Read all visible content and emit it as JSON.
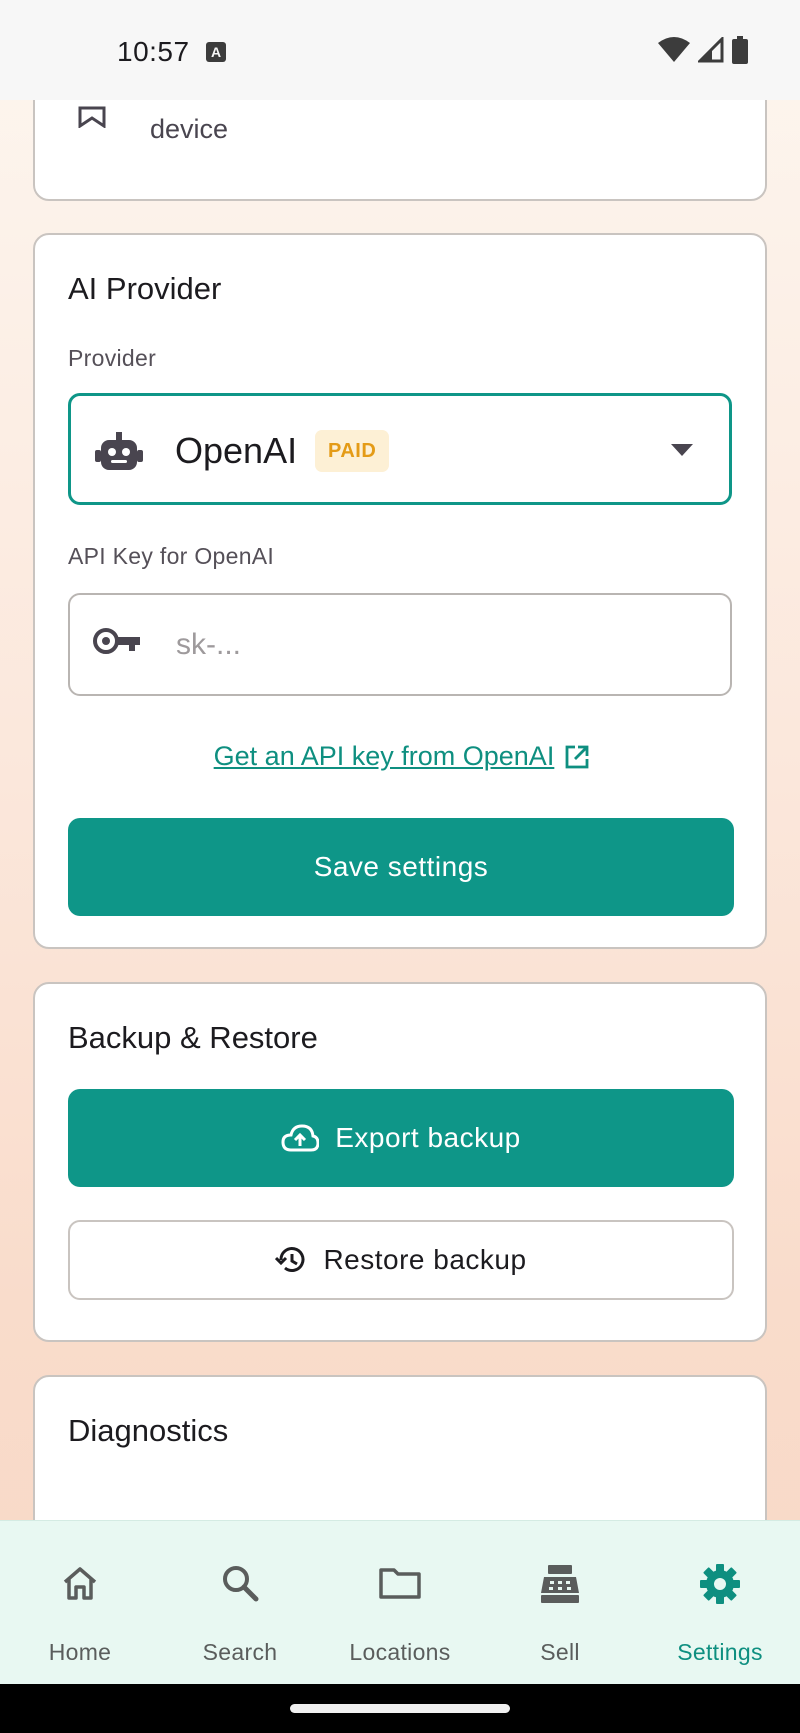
{
  "status_bar": {
    "time": "10:57",
    "indicator": "A"
  },
  "top_card": {
    "partial_text": "device"
  },
  "ai_provider": {
    "title": "AI Provider",
    "provider_label": "Provider",
    "provider_value": "OpenAI",
    "provider_badge": "PAID",
    "api_key_label": "API Key for OpenAI",
    "api_key_value": "",
    "api_key_placeholder": "sk-...",
    "api_key_link": "Get an API key from OpenAI",
    "save_label": "Save settings"
  },
  "backup": {
    "title": "Backup & Restore",
    "export_label": "Export backup",
    "restore_label": "Restore backup"
  },
  "diagnostics": {
    "title": "Diagnostics"
  },
  "bottom_nav": {
    "active": "Settings",
    "items": [
      {
        "label": "Home",
        "icon": "home-icon"
      },
      {
        "label": "Search",
        "icon": "search-icon"
      },
      {
        "label": "Locations",
        "icon": "folder-icon"
      },
      {
        "label": "Sell",
        "icon": "cash-register-icon"
      },
      {
        "label": "Settings",
        "icon": "gear-icon"
      }
    ]
  },
  "colors": {
    "accent": "#0e9688",
    "badge_text": "#e49b16",
    "badge_bg": "#fdf0d5",
    "nav_bg": "#e8f8f2"
  }
}
